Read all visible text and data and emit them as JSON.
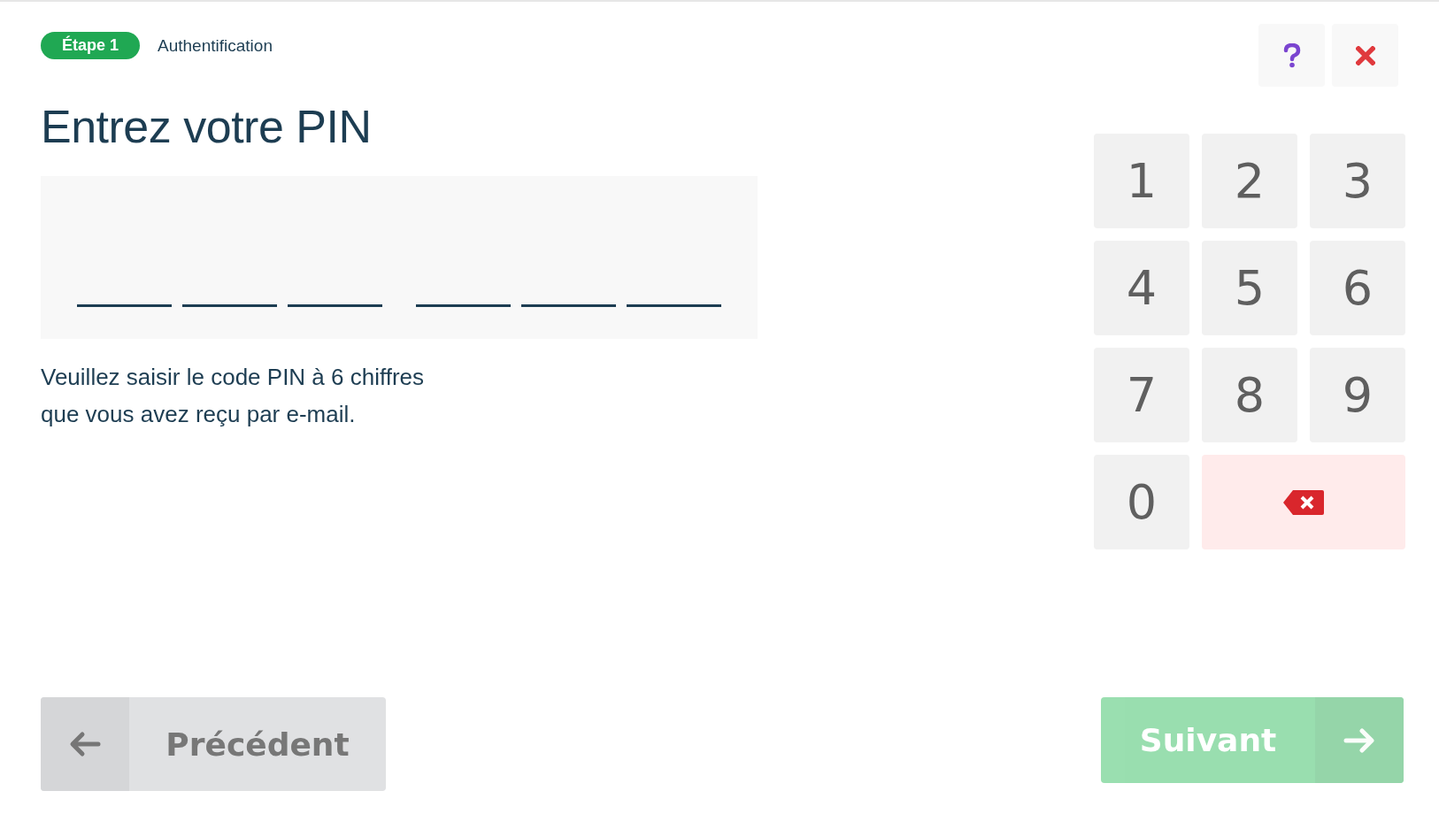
{
  "header": {
    "step_badge": "Étape 1",
    "step_title": "Authentification"
  },
  "toolbar": [
    {
      "kind": "help"
    },
    {
      "kind": "close"
    }
  ],
  "title": "Entrez votre PIN",
  "pin": {
    "slots": [
      {
        "filled": false
      },
      {
        "filled": false
      },
      {
        "filled": false
      },
      {
        "filled": false
      },
      {
        "filled": false
      },
      {
        "filled": false
      }
    ]
  },
  "description": "Veuillez saisir le code PIN à 6 chiffres que vous avez reçu par e-mail.",
  "keypad": [
    {
      "kind": "digit",
      "label": "1"
    },
    {
      "kind": "digit",
      "label": "2"
    },
    {
      "kind": "digit",
      "label": "3"
    },
    {
      "kind": "digit",
      "label": "4"
    },
    {
      "kind": "digit",
      "label": "5"
    },
    {
      "kind": "digit",
      "label": "6"
    },
    {
      "kind": "digit",
      "label": "7"
    },
    {
      "kind": "digit",
      "label": "8"
    },
    {
      "kind": "digit",
      "label": "9"
    },
    {
      "kind": "digit",
      "label": "0"
    },
    {
      "kind": "backspace"
    }
  ],
  "footer": {
    "previous": {
      "label": "Précédent",
      "disabled": false
    },
    "next": {
      "label": "Suivant",
      "disabled": true
    }
  }
}
